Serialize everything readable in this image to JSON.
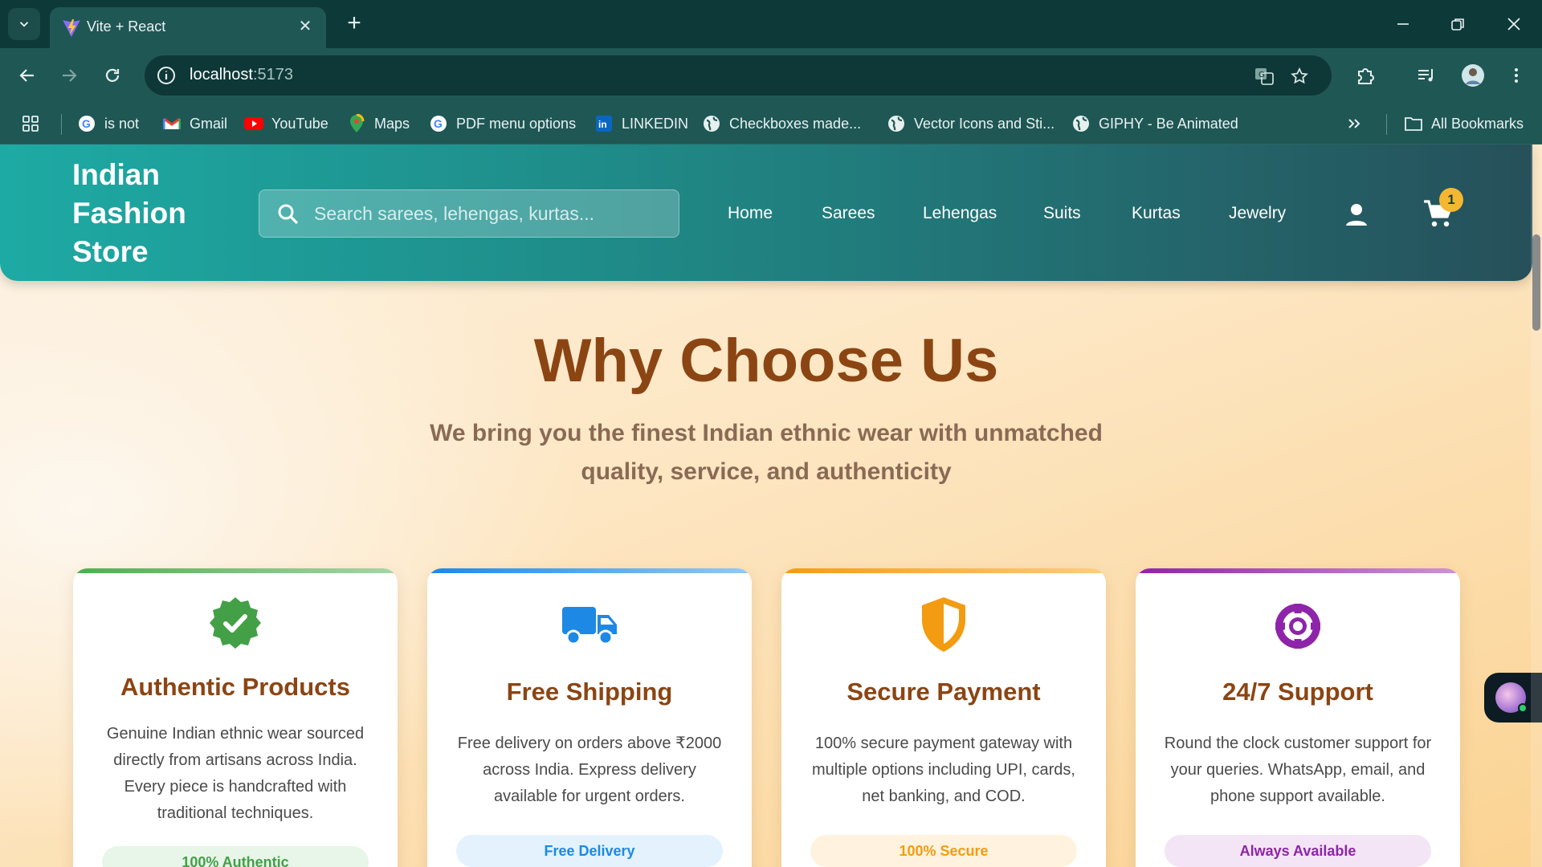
{
  "browser": {
    "tab_title": "Vite + React",
    "url_host": "localhost",
    "url_port": ":5173",
    "bookmarks": [
      {
        "label": "is not",
        "icon": "google-icon"
      },
      {
        "label": "Gmail",
        "icon": "gmail-icon"
      },
      {
        "label": "YouTube",
        "icon": "youtube-icon"
      },
      {
        "label": "Maps",
        "icon": "maps-icon"
      },
      {
        "label": "PDF menu options",
        "icon": "google-icon"
      },
      {
        "label": "LINKEDIN",
        "icon": "linkedin-icon"
      },
      {
        "label": "Checkboxes made...",
        "icon": "globe-icon"
      },
      {
        "label": "Vector Icons and Sti...",
        "icon": "globe-icon"
      },
      {
        "label": "GIPHY - Be Animated",
        "icon": "globe-icon"
      }
    ],
    "all_bookmarks": "All Bookmarks"
  },
  "header": {
    "brand_lines": [
      "Indian",
      "Fashion",
      "Store"
    ],
    "search_placeholder": "Search sarees, lehengas, kurtas...",
    "nav": [
      "Home",
      "Sarees",
      "Lehengas",
      "Suits",
      "Kurtas",
      "Jewelry"
    ],
    "cart_count": "1"
  },
  "section": {
    "title": "Why Choose Us",
    "subtitle": "We bring you the finest Indian ethnic wear with unmatched quality, service, and authenticity"
  },
  "cards": [
    {
      "title": "Authentic Products",
      "text": "Genuine Indian ethnic wear sourced directly from artisans across India. Every piece is handcrafted with traditional techniques.",
      "badge": "100% Authentic",
      "icon": "verified-badge-icon",
      "color": "#4caf50"
    },
    {
      "title": "Free Shipping",
      "text": "Free delivery on orders above ₹2000 across India. Express delivery available for urgent orders.",
      "badge": "Free Delivery",
      "icon": "truck-icon",
      "color": "#1e88e5"
    },
    {
      "title": "Secure Payment",
      "text": "100% secure payment gateway with multiple options including UPI, cards, net banking, and COD.",
      "badge": "100% Secure",
      "icon": "shield-icon",
      "color": "#f39c12"
    },
    {
      "title": "24/7 Support",
      "text": "Round the clock customer support for your queries. WhatsApp, email, and phone support available.",
      "badge": "Always Available",
      "icon": "lifebuoy-icon",
      "color": "#8e24aa"
    }
  ]
}
